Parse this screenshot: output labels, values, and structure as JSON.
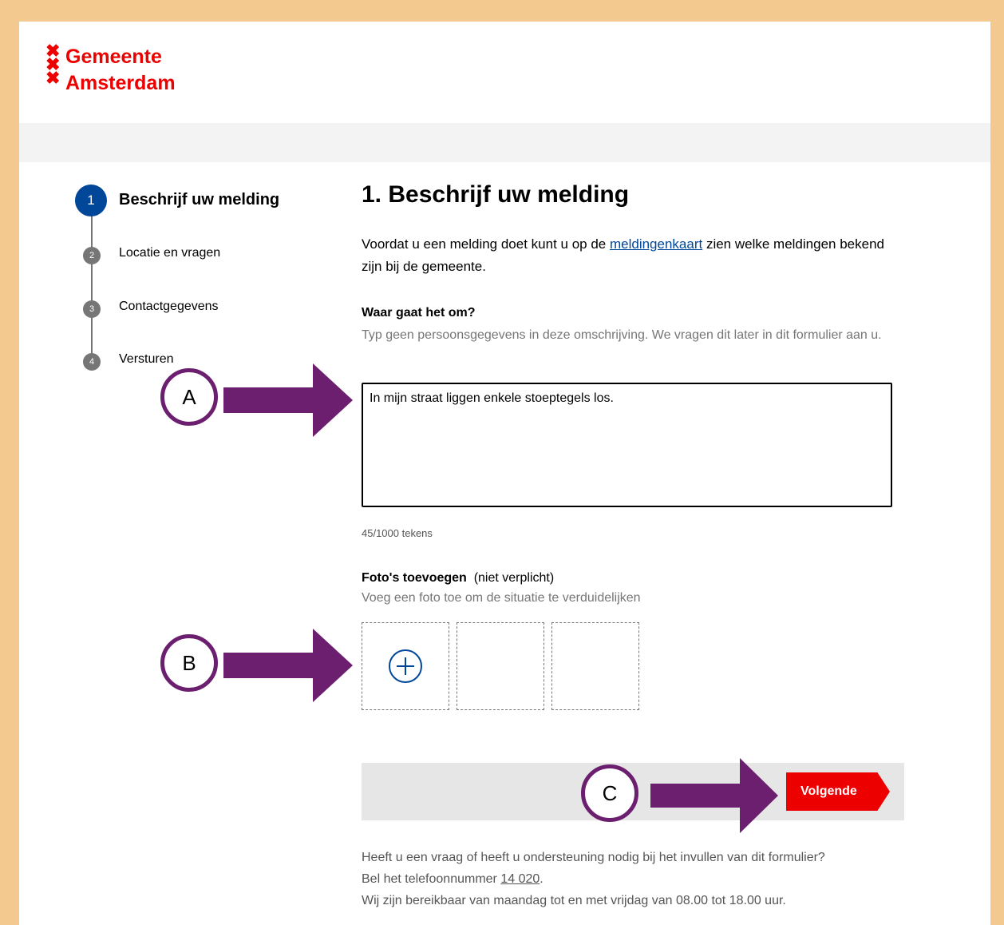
{
  "header": {
    "logo_line1": "Gemeente",
    "logo_line2": "Amsterdam",
    "logo_crosses": [
      "✖",
      "✖",
      "✖"
    ]
  },
  "stepper": {
    "steps": [
      {
        "number": "1",
        "label": "Beschrijf uw melding",
        "active": true
      },
      {
        "number": "2",
        "label": "Locatie en vragen",
        "active": false
      },
      {
        "number": "3",
        "label": "Contactgegevens",
        "active": false
      },
      {
        "number": "4",
        "label": "Versturen",
        "active": false
      }
    ]
  },
  "main": {
    "title": "1. Beschrijf uw melding",
    "intro_before": "Voordat u een melding doet kunt u op de ",
    "intro_link": "meldingenkaart",
    "intro_after": " zien welke meldingen bekend zijn bij de gemeente.",
    "question_label": "Waar gaat het om?",
    "question_hint": "Typ geen persoonsgegevens in deze omschrijving. We vragen dit later in dit formulier aan u.",
    "description_value": "In mijn straat liggen enkele stoeptegels los.",
    "char_counter": "45/1000 tekens",
    "photos_label": "Foto's toevoegen",
    "photos_optional": "(niet verplicht)",
    "photos_hint": "Voeg een foto toe om de situatie te verduidelijken",
    "next_button": "Volgende"
  },
  "footer": {
    "line1": "Heeft u een vraag of heeft u ondersteuning nodig bij het invullen van dit formulier?",
    "line2_before": "Bel het telefoonnummer ",
    "phone": "14 020",
    "line2_after": ".",
    "line3": "Wij zijn bereikbaar van maandag tot en met vrijdag van 08.00 tot 18.00 uur."
  },
  "annotations": {
    "a": "A",
    "b": "B",
    "c": "C"
  },
  "colors": {
    "frame": "#f4c98f",
    "brand_red": "#ec0000",
    "step_active": "#004699",
    "annotation_purple": "#6b1f6e"
  }
}
